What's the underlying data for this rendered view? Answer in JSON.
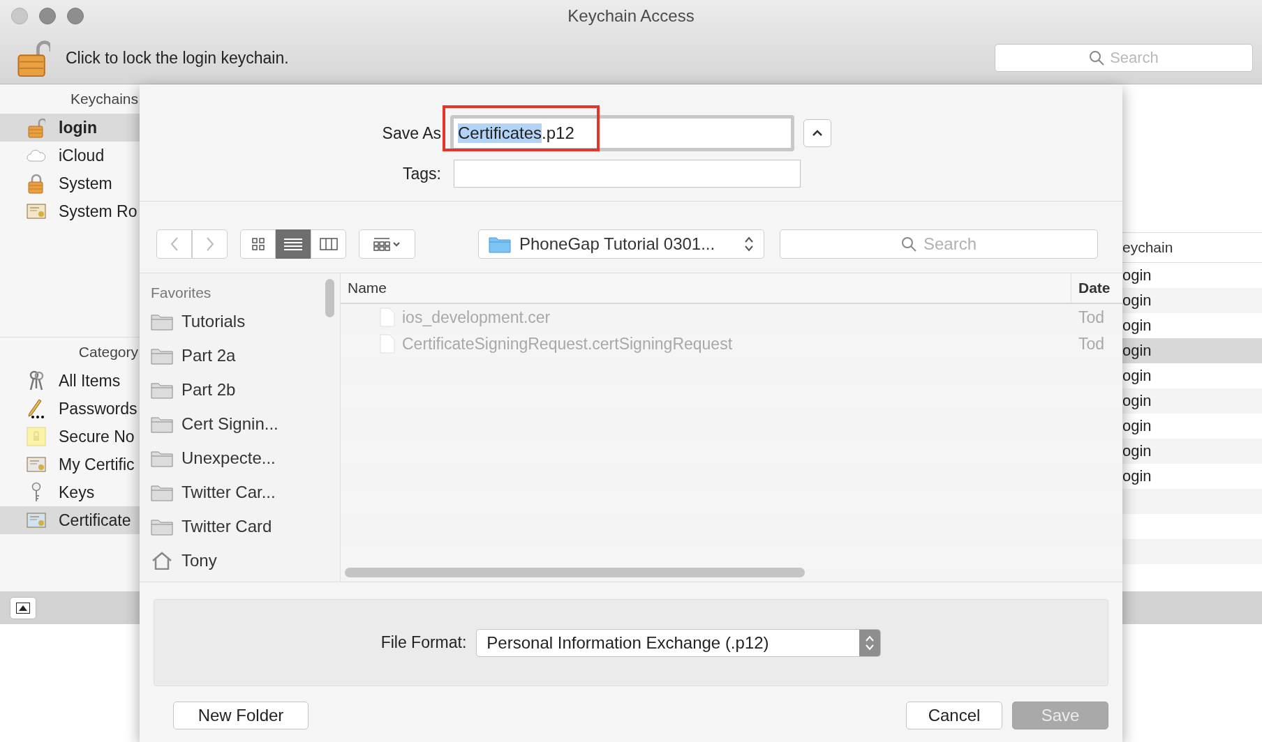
{
  "window": {
    "title": "Keychain Access"
  },
  "toolbar": {
    "lock_label": "Click to lock the login keychain.",
    "search": {
      "placeholder": "Search"
    }
  },
  "sidebar": {
    "keychains_header": "Keychains",
    "keychains": [
      {
        "label": "login",
        "selected": true,
        "default": true
      },
      {
        "label": "iCloud",
        "selected": false,
        "default": false
      },
      {
        "label": "System",
        "selected": false,
        "default": false
      },
      {
        "label": "System Ro",
        "selected": false,
        "default": false
      }
    ],
    "category_header": "Category",
    "categories": [
      {
        "label": "All Items",
        "selected": false
      },
      {
        "label": "Passwords",
        "selected": false
      },
      {
        "label": "Secure No",
        "selected": false
      },
      {
        "label": "My Certific",
        "selected": false
      },
      {
        "label": "Keys",
        "selected": false
      },
      {
        "label": "Certificate",
        "selected": true
      }
    ]
  },
  "table": {
    "columns": [
      "eychain"
    ],
    "rows": [
      {
        "cell": "ogin",
        "selected": false
      },
      {
        "cell": "ogin",
        "selected": false
      },
      {
        "cell": "ogin",
        "selected": false
      },
      {
        "cell": "ogin",
        "selected": true
      },
      {
        "cell": "ogin",
        "selected": false
      },
      {
        "cell": "ogin",
        "selected": false
      },
      {
        "cell": "ogin",
        "selected": false
      },
      {
        "cell": "ogin",
        "selected": false
      },
      {
        "cell": "ogin",
        "selected": false
      }
    ]
  },
  "save_sheet": {
    "save_as_label": "Save As",
    "filename": {
      "selected_part": "Certificates",
      "rest": ".p12"
    },
    "tags_label": "Tags:",
    "view_modes": [
      {
        "selected": false
      },
      {
        "selected": true
      },
      {
        "selected": false
      }
    ],
    "location": "PhoneGap Tutorial 0301...",
    "search": {
      "placeholder": "Search"
    },
    "favorites_header": "Favorites",
    "favorites": [
      {
        "label": "Tutorials",
        "kind": "folder"
      },
      {
        "label": "Part 2a",
        "kind": "folder"
      },
      {
        "label": "Part 2b",
        "kind": "folder"
      },
      {
        "label": "Cert Signin...",
        "kind": "folder"
      },
      {
        "label": "Unexpecte...",
        "kind": "folder"
      },
      {
        "label": "Twitter Car...",
        "kind": "folder"
      },
      {
        "label": "Twitter Card",
        "kind": "folder"
      },
      {
        "label": "Tony",
        "kind": "home"
      }
    ],
    "files": {
      "columns": [
        "Name",
        "Date"
      ],
      "rows": [
        {
          "name": "ios_development.cer",
          "date": "Tod",
          "disabled": true
        },
        {
          "name": "CertificateSigningRequest.certSigningRequest",
          "date": "Tod",
          "disabled": true
        }
      ]
    },
    "file_format_label": "File Format:",
    "file_format": "Personal Information Exchange (.p12)",
    "buttons": [
      {
        "label": "New Folder",
        "disabled": false
      },
      {
        "label": "Cancel",
        "disabled": false
      },
      {
        "label": "Save",
        "disabled": true
      }
    ]
  }
}
